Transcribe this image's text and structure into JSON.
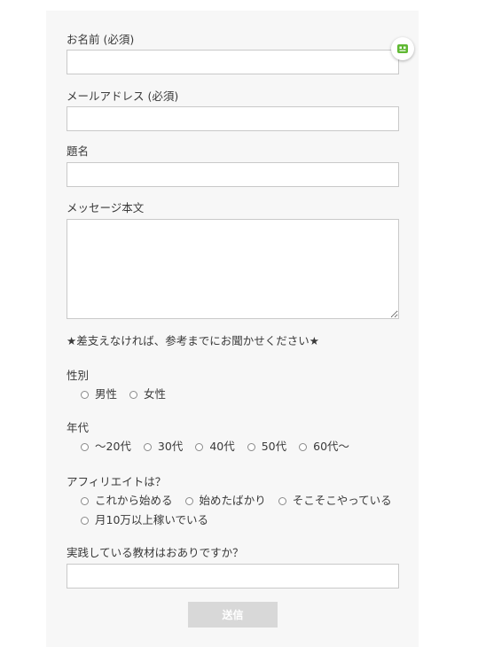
{
  "form": {
    "name_label": "お名前 (必須)",
    "email_label": "メールアドレス (必須)",
    "subject_label": "題名",
    "message_label": "メッセージ本文",
    "notice": "★差支えなければ、参考までにお聞かせください★",
    "gender": {
      "label": "性別",
      "options": [
        "男性",
        "女性"
      ]
    },
    "age": {
      "label": "年代",
      "options": [
        "～20代",
        "30代",
        "40代",
        "50代",
        "60代～"
      ]
    },
    "affiliate": {
      "label": "アフィリエイトは？",
      "options": [
        "これから始める",
        "始めたばかり",
        "そこそこやっている",
        "月10万以上稼いでいる"
      ]
    },
    "materials_label": "実践している教材はおありですか？",
    "submit_label": "送信"
  },
  "colors": {
    "panel_bg": "#f7f7f7",
    "field_border": "#c9c9c9",
    "submit_bg": "#d8d8d8",
    "widget_icon": "#5fb832"
  },
  "icons": {
    "widget": "robot-icon"
  }
}
